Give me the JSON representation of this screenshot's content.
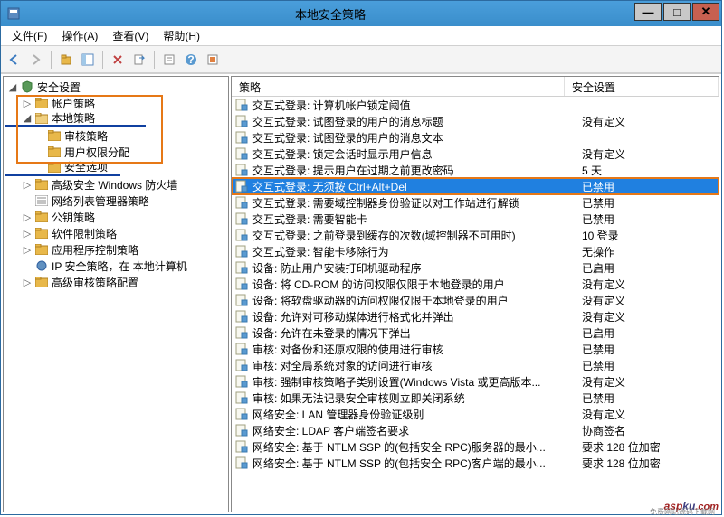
{
  "window": {
    "title": "本地安全策略"
  },
  "menu": {
    "file": "文件(F)",
    "action": "操作(A)",
    "view": "查看(V)",
    "help": "帮助(H)"
  },
  "tree": {
    "root": "安全设置",
    "account": "帐户策略",
    "local": "本地策略",
    "audit": "审核策略",
    "rights": "用户权限分配",
    "options": "安全选项",
    "firewall": "高级安全 Windows 防火墙",
    "netlist": "网络列表管理器策略",
    "pubkey": "公钥策略",
    "software": "软件限制策略",
    "appctrl": "应用程序控制策略",
    "ipsec": "IP 安全策略，在 本地计算机",
    "advaudit": "高级审核策略配置"
  },
  "headers": {
    "policy": "策略",
    "setting": "安全设置"
  },
  "policies": [
    {
      "name": "交互式登录: 计算机帐户锁定阈值",
      "setting": ""
    },
    {
      "name": "交互式登录: 试图登录的用户的消息标题",
      "setting": "没有定义"
    },
    {
      "name": "交互式登录: 试图登录的用户的消息文本",
      "setting": ""
    },
    {
      "name": "交互式登录: 锁定会话时显示用户信息",
      "setting": "没有定义"
    },
    {
      "name": "交互式登录: 提示用户在过期之前更改密码",
      "setting": "5 天"
    },
    {
      "name": "交互式登录: 无须按 Ctrl+Alt+Del",
      "setting": "已禁用",
      "selected": true
    },
    {
      "name": "交互式登录: 需要域控制器身份验证以对工作站进行解锁",
      "setting": "已禁用"
    },
    {
      "name": "交互式登录: 需要智能卡",
      "setting": "已禁用"
    },
    {
      "name": "交互式登录: 之前登录到缓存的次数(域控制器不可用时)",
      "setting": "10 登录"
    },
    {
      "name": "交互式登录: 智能卡移除行为",
      "setting": "无操作"
    },
    {
      "name": "设备: 防止用户安装打印机驱动程序",
      "setting": "已启用"
    },
    {
      "name": "设备: 将 CD-ROM 的访问权限仅限于本地登录的用户",
      "setting": "没有定义"
    },
    {
      "name": "设备: 将软盘驱动器的访问权限仅限于本地登录的用户",
      "setting": "没有定义"
    },
    {
      "name": "设备: 允许对可移动媒体进行格式化并弹出",
      "setting": "没有定义"
    },
    {
      "name": "设备: 允许在未登录的情况下弹出",
      "setting": "已启用"
    },
    {
      "name": "审核: 对备份和还原权限的使用进行审核",
      "setting": "已禁用"
    },
    {
      "name": "审核: 对全局系统对象的访问进行审核",
      "setting": "已禁用"
    },
    {
      "name": "审核: 强制审核策略子类别设置(Windows Vista 或更高版本...",
      "setting": "没有定义"
    },
    {
      "name": "审核: 如果无法记录安全审核则立即关闭系统",
      "setting": "已禁用"
    },
    {
      "name": "网络安全: LAN 管理器身份验证级别",
      "setting": "没有定义"
    },
    {
      "name": "网络安全: LDAP 客户端签名要求",
      "setting": "协商签名"
    },
    {
      "name": "网络安全: 基于 NTLM SSP 的(包括安全 RPC)服务器的最小...",
      "setting": "要求 128 位加密"
    },
    {
      "name": "网络安全: 基于 NTLM SSP 的(包括安全 RPC)客户端的最小...",
      "setting": "要求 128 位加密"
    }
  ],
  "watermark": {
    "asp": "asp",
    "ku": "ku",
    "com": ".com",
    "sub": "免费网站源码下载网"
  }
}
